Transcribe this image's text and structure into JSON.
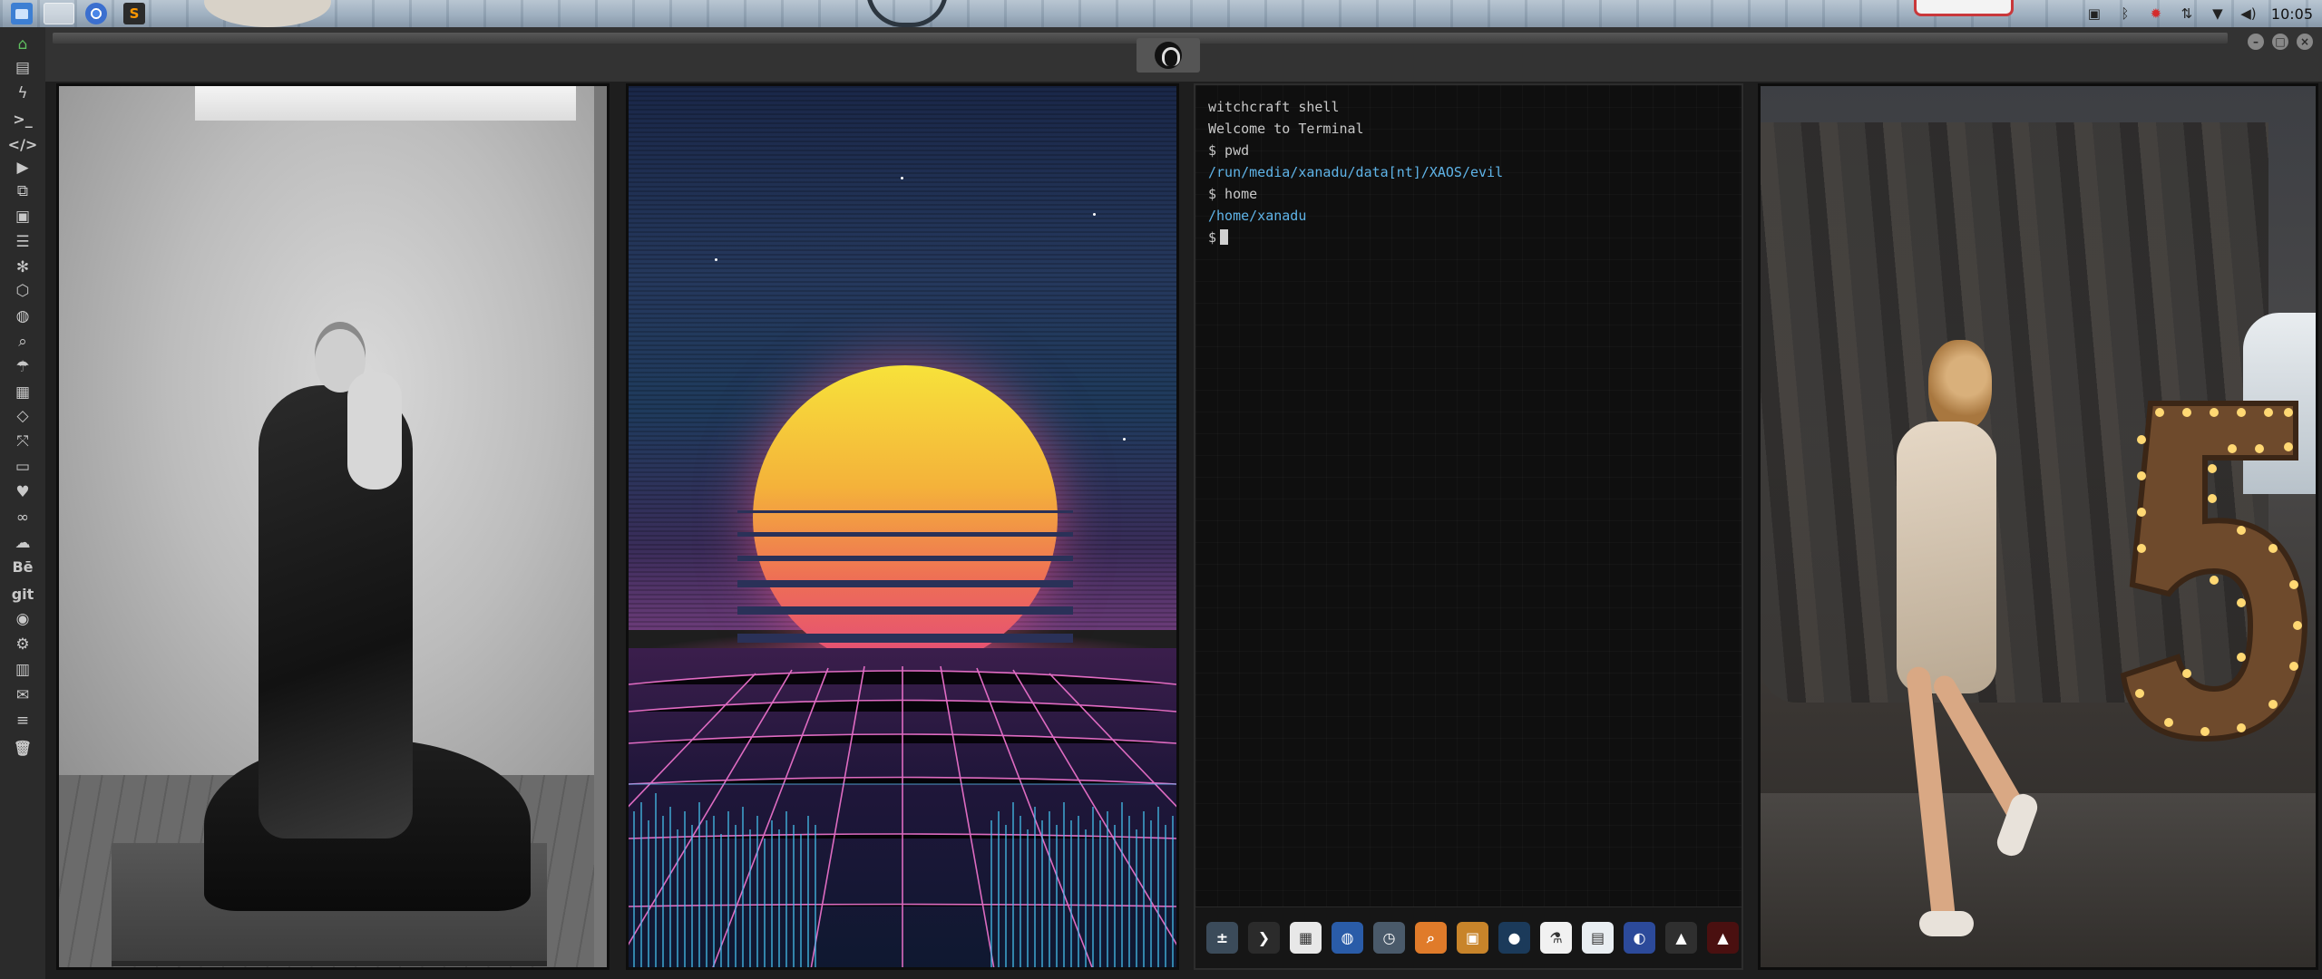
{
  "topbar": {
    "apps": [
      {
        "name": "files-icon"
      },
      {
        "name": "blank-window"
      },
      {
        "name": "chrome-icon"
      },
      {
        "name": "sublime-icon",
        "glyph": "S"
      }
    ],
    "tray": {
      "icons": [
        "screenshot-icon",
        "bluetooth-icon",
        "alert-icon",
        "network-icon",
        "wifi-icon",
        "volume-icon"
      ],
      "clock": "10:05"
    }
  },
  "window": {
    "buttons": [
      "minimize",
      "maximize",
      "close"
    ]
  },
  "dock": {
    "items": [
      {
        "name": "home",
        "glyph": "⌂",
        "active": true
      },
      {
        "name": "document",
        "glyph": "▤"
      },
      {
        "name": "flash",
        "glyph": "ϟ"
      },
      {
        "name": "terminal",
        "glyph": ">_"
      },
      {
        "name": "code",
        "glyph": "</>"
      },
      {
        "name": "media-play",
        "glyph": "▶"
      },
      {
        "name": "copy",
        "glyph": "⧉"
      },
      {
        "name": "image",
        "glyph": "▣"
      },
      {
        "name": "news",
        "glyph": "☰"
      },
      {
        "name": "settings",
        "glyph": "✻"
      },
      {
        "name": "hex",
        "glyph": "⬡"
      },
      {
        "name": "globe",
        "glyph": "◍"
      },
      {
        "name": "search",
        "glyph": "⌕"
      },
      {
        "name": "umbrella",
        "glyph": "☂"
      },
      {
        "name": "contact",
        "glyph": "▦"
      },
      {
        "name": "tag",
        "glyph": "◇"
      },
      {
        "name": "expand",
        "glyph": "⤧"
      },
      {
        "name": "youtube",
        "glyph": "▭"
      },
      {
        "name": "heart",
        "glyph": "♥"
      },
      {
        "name": "link",
        "glyph": "∞"
      },
      {
        "name": "cloud",
        "glyph": "☁"
      },
      {
        "name": "behance",
        "glyph": "Bē"
      },
      {
        "name": "git",
        "glyph": "git"
      },
      {
        "name": "github",
        "glyph": "◉"
      },
      {
        "name": "cogs",
        "glyph": "⚙"
      },
      {
        "name": "map",
        "glyph": "▥"
      },
      {
        "name": "mail",
        "glyph": "✉"
      },
      {
        "name": "list",
        "glyph": "≡"
      },
      {
        "name": "trash",
        "glyph": "🗑"
      }
    ]
  },
  "terminal": {
    "lines": [
      {
        "text": "witchcraft shell",
        "kind": "plain"
      },
      {
        "text": "Welcome to Terminal",
        "kind": "plain"
      },
      {
        "text": "$ pwd",
        "kind": "plain"
      },
      {
        "text": "/run/media/xanadu/data[nt]/XAOS/evil",
        "kind": "out"
      },
      {
        "text": "$ home",
        "kind": "plain"
      },
      {
        "text": "/home/xanadu",
        "kind": "out"
      },
      {
        "text": "$",
        "kind": "prompt"
      }
    ],
    "launcher": [
      {
        "name": "calculator",
        "bg": "#3b4b5a",
        "glyph": "±"
      },
      {
        "name": "terminal",
        "bg": "#2b2b2b",
        "glyph": "❯"
      },
      {
        "name": "calendar",
        "bg": "#e8e8e8",
        "glyph": "▦"
      },
      {
        "name": "browser",
        "bg": "#2a5ca8",
        "glyph": "◍"
      },
      {
        "name": "clock",
        "bg": "#4a5a6a",
        "glyph": "◷"
      },
      {
        "name": "search",
        "bg": "#e07b2a",
        "glyph": "⌕"
      },
      {
        "name": "photos",
        "bg": "#c8842a",
        "glyph": "▣"
      },
      {
        "name": "planet",
        "bg": "#1b3a5a",
        "glyph": "●"
      },
      {
        "name": "lab",
        "bg": "#f1f1f1",
        "glyph": "⚗"
      },
      {
        "name": "editor",
        "bg": "#e9eef2",
        "glyph": "▤"
      },
      {
        "name": "web",
        "bg": "#2c4a9a",
        "glyph": "◐"
      },
      {
        "name": "pyramid",
        "bg": "#2f2f2f",
        "glyph": "▲"
      },
      {
        "name": "arrow",
        "bg": "#4a1010",
        "glyph": "▲"
      }
    ]
  },
  "colors": {
    "accent_output": "#5fb4e8",
    "dock_active": "#5fbf5f"
  }
}
